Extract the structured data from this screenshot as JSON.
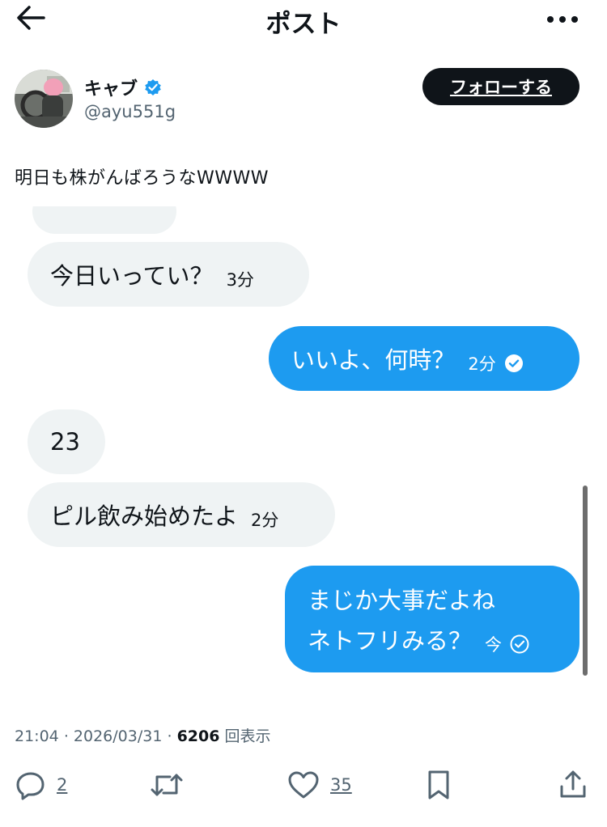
{
  "header": {
    "title": "ポスト",
    "back_icon": "arrow-left-icon",
    "more_icon": "more-icon"
  },
  "author": {
    "name": "キャブ",
    "handle": "@ayu551g",
    "follow_label": "フォローする",
    "verified_color": "#1d9bf0"
  },
  "post": {
    "text": "明日も株がんばろうなWWWW"
  },
  "chat": {
    "messages": [
      {
        "side": "in",
        "text": "今日いってい？",
        "time": "3分"
      },
      {
        "side": "out",
        "text": "いいよ、何時？",
        "time": "2分",
        "read": true
      },
      {
        "side": "in",
        "text": "23"
      },
      {
        "side": "in",
        "text": "ピル飲み始めたよ",
        "time": "2分"
      },
      {
        "side": "out",
        "lines": [
          "まじか大事だよね",
          "ネトフリみる？"
        ],
        "time": "今",
        "read": false
      }
    ]
  },
  "meta": {
    "time": "21:04",
    "date": "2026/03/31",
    "views": "6206",
    "views_label": "回表示"
  },
  "actions": {
    "reply_count": "2",
    "repost_count": "",
    "like_count": "35"
  },
  "colors": {
    "accent": "#1d9bf0",
    "text": "#0f1419",
    "muted": "#536471",
    "bubble_in": "#eff3f4"
  }
}
